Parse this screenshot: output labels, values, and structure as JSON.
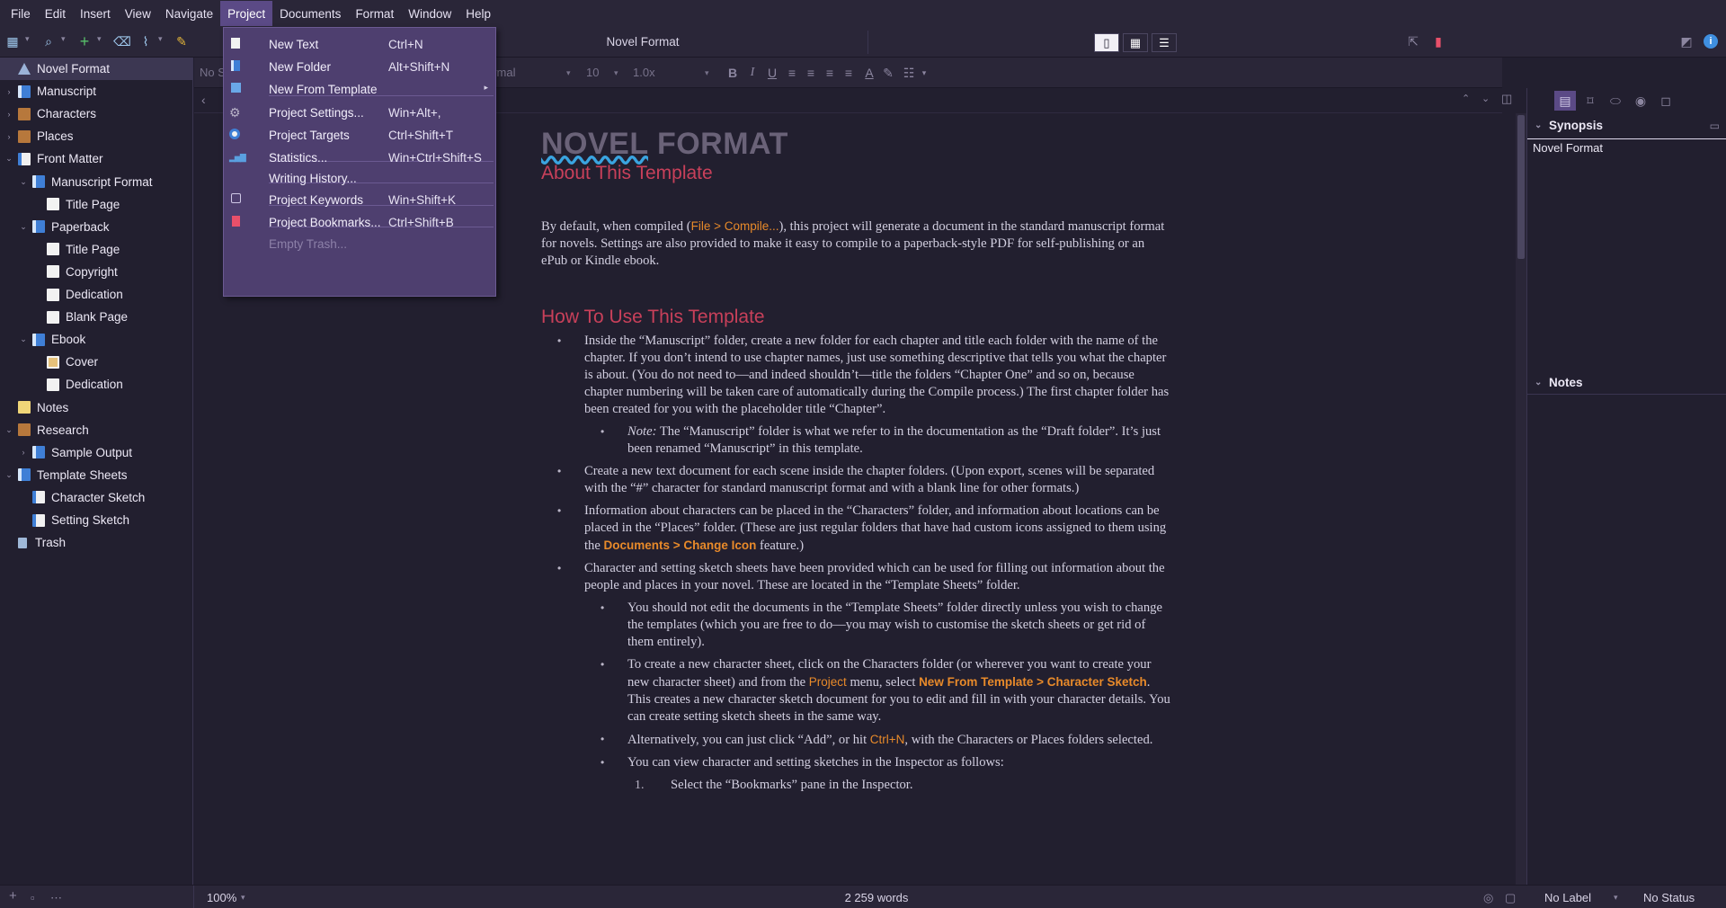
{
  "menubar": [
    "File",
    "Edit",
    "Insert",
    "View",
    "Navigate",
    "Project",
    "Documents",
    "Format",
    "Window",
    "Help"
  ],
  "active_menu": "Project",
  "toolbar": {
    "doc_title": "Novel Format"
  },
  "formatbar": {
    "style_placeholder": "No S",
    "style": "ormal",
    "font_size": "10",
    "line_spacing": "1.0x"
  },
  "binder": [
    {
      "label": "Novel Format",
      "indent": 0,
      "icon": "tri",
      "arrow": "",
      "selected": true
    },
    {
      "label": "Manuscript",
      "indent": 0,
      "icon": "folder-blue",
      "arrow": "›"
    },
    {
      "label": "Characters",
      "indent": 0,
      "icon": "folder-brown",
      "arrow": "›"
    },
    {
      "label": "Places",
      "indent": 0,
      "icon": "folder-brown",
      "arrow": "›"
    },
    {
      "label": "Front Matter",
      "indent": 0,
      "icon": "folder-doc",
      "arrow": "⌄"
    },
    {
      "label": "Manuscript Format",
      "indent": 1,
      "icon": "folder-blue",
      "arrow": "⌄"
    },
    {
      "label": "Title Page",
      "indent": 2,
      "icon": "doc",
      "arrow": ""
    },
    {
      "label": "Paperback",
      "indent": 1,
      "icon": "folder-blue",
      "arrow": "⌄"
    },
    {
      "label": "Title Page",
      "indent": 2,
      "icon": "doc",
      "arrow": ""
    },
    {
      "label": "Copyright",
      "indent": 2,
      "icon": "doc",
      "arrow": ""
    },
    {
      "label": "Dedication",
      "indent": 2,
      "icon": "doc",
      "arrow": ""
    },
    {
      "label": "Blank Page",
      "indent": 2,
      "icon": "doc",
      "arrow": ""
    },
    {
      "label": "Ebook",
      "indent": 1,
      "icon": "folder-blue",
      "arrow": "⌄"
    },
    {
      "label": "Cover",
      "indent": 2,
      "icon": "img",
      "arrow": ""
    },
    {
      "label": "Dedication",
      "indent": 2,
      "icon": "doc",
      "arrow": ""
    },
    {
      "label": "Notes",
      "indent": 0,
      "icon": "note",
      "arrow": ""
    },
    {
      "label": "Research",
      "indent": 0,
      "icon": "folder-brown",
      "arrow": "⌄"
    },
    {
      "label": "Sample Output",
      "indent": 1,
      "icon": "folder-blue",
      "arrow": "›"
    },
    {
      "label": "Template Sheets",
      "indent": 0,
      "icon": "folder-blue",
      "arrow": "⌄"
    },
    {
      "label": "Character Sketch",
      "indent": 1,
      "icon": "folder-doc",
      "arrow": ""
    },
    {
      "label": "Setting Sketch",
      "indent": 1,
      "icon": "folder-doc",
      "arrow": ""
    },
    {
      "label": "Trash",
      "indent": 0,
      "icon": "trash",
      "arrow": ""
    }
  ],
  "project_menu": [
    {
      "label": "New Text",
      "shortcut": "Ctrl+N",
      "icon": "doc"
    },
    {
      "label": "New Folder",
      "shortcut": "Alt+Shift+N",
      "icon": "folder"
    },
    {
      "label": "New From Template",
      "shortcut": "",
      "icon": "template",
      "submenu": true
    },
    {
      "label": "Project Settings...",
      "shortcut": "Win+Alt+,",
      "icon": "gear"
    },
    {
      "label": "Project Targets",
      "shortcut": "Ctrl+Shift+T",
      "icon": "target"
    },
    {
      "label": "Statistics...",
      "shortcut": "Win+Ctrl+Shift+S",
      "icon": "chart"
    },
    {
      "label": "Writing History...",
      "shortcut": "",
      "icon": ""
    },
    {
      "label": "Project Keywords",
      "shortcut": "Win+Shift+K",
      "icon": "keyword"
    },
    {
      "label": "Project Bookmarks...",
      "shortcut": "Ctrl+Shift+B",
      "icon": "bookmark"
    },
    {
      "label": "Empty Trash...",
      "shortcut": "",
      "icon": "",
      "disabled": true
    }
  ],
  "document": {
    "title_a": "NOVEL",
    "title_b": " FORMAT",
    "subtitle": "About This Template",
    "intro_1": "By default, when compiled (",
    "intro_orange": "File > Compile...",
    "intro_2": "), this project will generate a document in the standard manuscript format for novels. Settings are also provided to make it easy to compile to a paperback-style PDF for self-publishing or an ePub or Kindle ebook.",
    "how_heading": "How To Use This Template",
    "b1": "Inside the “Manuscript” folder, create a new folder for each chapter and title each folder with the name of the chapter. If you don’t intend to use chapter names, just use something descriptive that tells you what the chapter is about. (You do not need to—and indeed shouldn’t—title the folders “Chapter One” and so on, because chapter numbering will be taken care of automatically during the Compile process.) The first chapter folder has been created for you with the placeholder title “Chapter”.",
    "b1_note_label": "Note:",
    "b1_note": " The “Manuscript” folder is what we refer to in the documentation as the “Draft folder”. It’s just been renamed “Manuscript” in this template.",
    "b2": "Create a new text document for each scene inside the chapter folders. (Upon export, scenes will be separated with the “#” character for standard manuscript format and with a blank line for other formats.)",
    "b3_1": "Information about characters can be placed in the “Characters” folder, and information about locations can be placed in the “Places” folder. (These are just regular folders that have had custom icons assigned to them using the ",
    "b3_orange": "Documents > Change Icon",
    "b3_2": " feature.)",
    "b4": "Character and setting sketch sheets have been provided which can be used for filling out information about the people and places in your novel. These are located in the “Template Sheets” folder.",
    "b4a": "You should not edit the documents in the “Template Sheets” folder directly unless you wish to change the templates (which you are free to do—you may wish to customise the sketch sheets or get rid of them entirely).",
    "b4b_1": "To create a new character sheet, click on the Characters folder (or wherever you want to create your new character sheet) and from the ",
    "b4b_project": "Project",
    "b4b_2": " menu, select ",
    "b4b_orange": "New From Template > Character Sketch",
    "b4b_3": ". This creates a new character sketch document for you to edit and fill in with your character details. You can create setting sketch sheets in the same way.",
    "b4c_1": "Alternatively, you can just click “Add”, or hit ",
    "b4c_orange": "Ctrl+N",
    "b4c_2": ", with the Characters or Places folders selected.",
    "b4d": "You can view character and setting sketches in the Inspector as follows:",
    "b4d_1_num": "1.",
    "b4d_1": "Select the “Bookmarks” pane in the Inspector."
  },
  "inspector": {
    "synopsis_label": "Synopsis",
    "synopsis_text": "Novel Format",
    "notes_label": "Notes"
  },
  "statusbar": {
    "zoom": "100%",
    "word_count": "2 259 words",
    "label": "No Label",
    "status": "No Status"
  }
}
